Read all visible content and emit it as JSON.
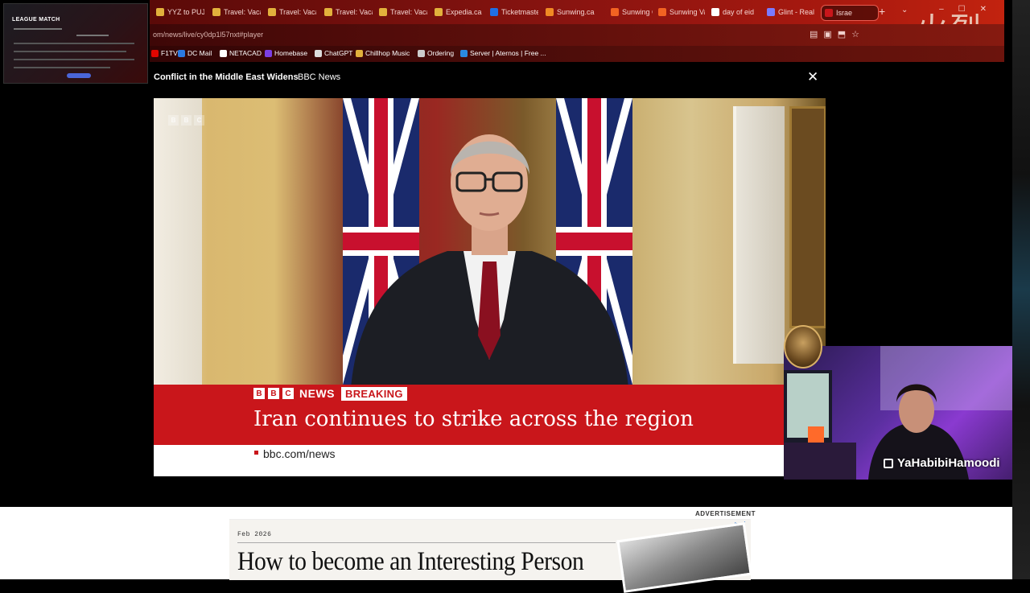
{
  "stream_overlay": {
    "mini_window_title": "LEAGUE MATCH",
    "streamer_handle": "YaHabibiHamoodi"
  },
  "browser": {
    "tabs": [
      {
        "label": "YYZ to PUJ",
        "icon_color": "#e2b13c"
      },
      {
        "label": "Travel: Vaca",
        "icon_color": "#e2b13c"
      },
      {
        "label": "Travel: Vaca",
        "icon_color": "#e2b13c"
      },
      {
        "label": "Travel: Vaca",
        "icon_color": "#e2b13c"
      },
      {
        "label": "Travel: Vaca",
        "icon_color": "#e2b13c"
      },
      {
        "label": "Expedia.ca",
        "icon_color": "#e2b13c"
      },
      {
        "label": "Ticketmaster",
        "icon_color": "#1f6fe5"
      },
      {
        "label": "Sunwing.ca",
        "icon_color": "#f08a24"
      },
      {
        "label": "Sunwing G",
        "icon_color": "#f26322"
      },
      {
        "label": "Sunwing Va",
        "icon_color": "#f26322"
      },
      {
        "label": "day of eid",
        "icon_color": "#ffffff"
      },
      {
        "label": "Glint - Real",
        "icon_color": "#7a7aff"
      },
      {
        "label": "Israe",
        "icon_color": "#c9161b",
        "active": true
      }
    ],
    "url": "om/news/live/cy0dp1l57nxt#player",
    "bookmarks": [
      {
        "label": "F1TV",
        "icon_color": "#e10600"
      },
      {
        "label": "DC Mail",
        "icon_color": "#2a7ae2"
      },
      {
        "label": "NETACAD",
        "icon_color": "#ffffff"
      },
      {
        "label": "Homebase",
        "icon_color": "#7b3fe4"
      },
      {
        "label": "ChatGPT",
        "icon_color": "#dddddd"
      },
      {
        "label": "Chillhop Music",
        "icon_color": "#e2b13c"
      },
      {
        "label": "Ordering",
        "icon_color": "#cccccc"
      },
      {
        "label": "Server | Aternos | Free ...",
        "icon_color": "#2a8ae2"
      }
    ],
    "decoration_text": "火烈"
  },
  "video": {
    "title": "Conflict in the Middle East Widens",
    "source": "BBC News",
    "close_glyph": "✕",
    "watermark": [
      "B",
      "B",
      "C"
    ],
    "brand_letters": [
      "B",
      "B",
      "C"
    ],
    "brand_word": "NEWS",
    "breaking_label": "BREAKING",
    "headline": "Iran continues to strike across the region",
    "site_url": "bbc.com/news"
  },
  "advertisement": {
    "label": "ADVERTISEMENT",
    "date": "Feb 2026",
    "headline": "How to become an Interesting Person",
    "icons": "▷ ⋮"
  }
}
